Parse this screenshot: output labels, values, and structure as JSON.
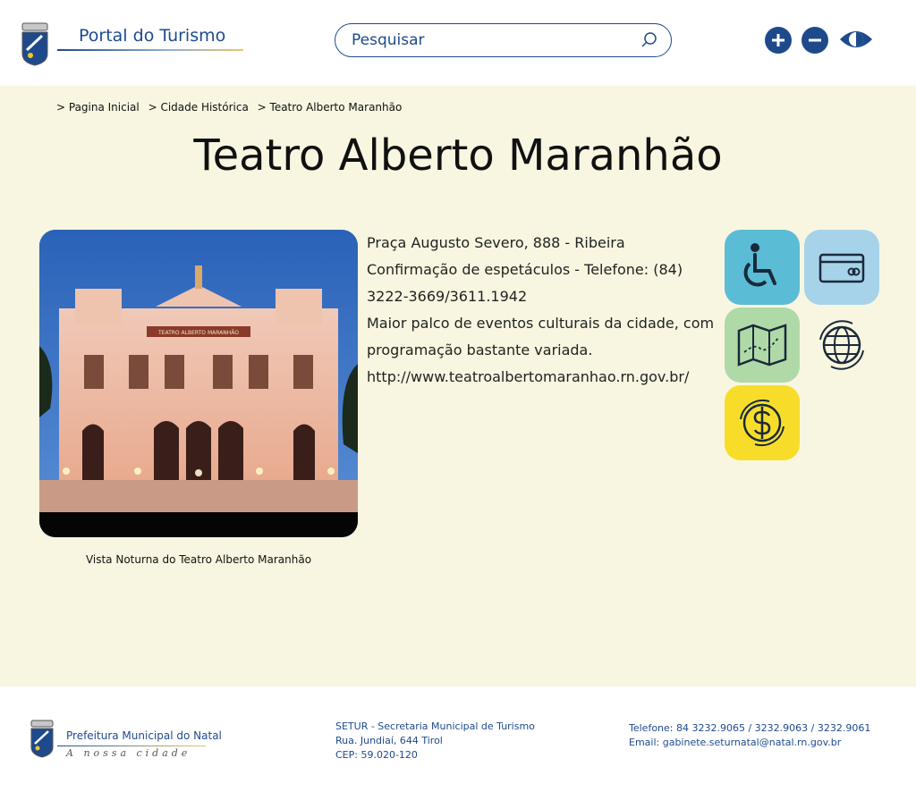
{
  "header": {
    "portal_title": "Portal do Turismo",
    "search_placeholder": "Pesquisar",
    "icons": [
      "search-icon",
      "zoom-in-icon",
      "zoom-out-icon",
      "contrast-icon"
    ]
  },
  "breadcrumb": [
    "> Pagina Inicial",
    "> Cidade Histórica",
    "> Teatro Alberto Maranhão"
  ],
  "page_title": "Teatro Alberto Maranhão",
  "photo": {
    "caption": "Vista Noturna do Teatro Alberto Maranhão",
    "facade_text": "TEATRO ALBERTO MARANHÃO"
  },
  "info": {
    "address": "Praça Augusto Severo, 888 - Ribeira",
    "phone": " Confirmação de espetáculos - Telefone: (84) 3222-3669/3611.1942",
    "description": " Maior palco de eventos culturais da cidade, com programação bastante variada.",
    "website": "http://www.teatroalbertomaranhao.rn.gov.br/"
  },
  "feature_icons": [
    {
      "name": "accessibility-icon",
      "color": "#5bbcd6"
    },
    {
      "name": "credit-card-icon",
      "color": "#a6d3ea"
    },
    {
      "name": "map-icon",
      "color": "#b0d9a8"
    },
    {
      "name": "globe-icon",
      "color": "#f8f6e0"
    },
    {
      "name": "money-icon",
      "color": "#f7dd2a"
    }
  ],
  "footer": {
    "prefeitura": "Prefeitura Municipal do Natal",
    "slogan": "A nossa cidade",
    "address_lines": [
      "SETUR - Secretaria Municipal de Turismo",
      "Rua. Jundiaí, 644 Tirol",
      "CEP: 59.020-120"
    ],
    "phone": "Telefone: 84 3232.9065 / 3232.9063 / 3232.9061",
    "email": "Email: gabinete.seturnatal@natal.rn.gov.br"
  },
  "colors": {
    "brand_blue": "#1e4a8c",
    "page_bg": "#f8f6e0"
  }
}
